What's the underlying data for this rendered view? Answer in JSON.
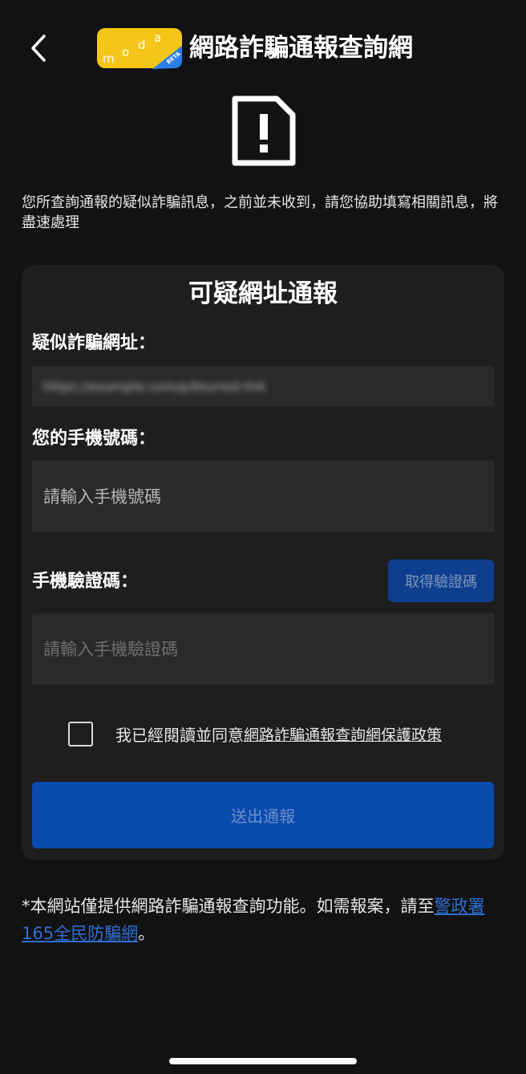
{
  "header": {
    "back_icon": "chevron-left-icon",
    "logo": {
      "text": "moda",
      "badge": "BETA",
      "color": "#f5c518"
    },
    "title": "網路詐騙通報查詢網"
  },
  "alert": {
    "icon": "file-exclamation-icon"
  },
  "intro_text": "您所查詢通報的疑似詐騙訊息，之前並未收到，請您協助填寫相關訊息，將盡速處理",
  "form": {
    "title": "可疑網址通報",
    "url_label": "疑似詐騙網址：",
    "url_value": "https://example.com/p/blurred-link",
    "phone_label": "您的手機號碼：",
    "phone_placeholder": "請輸入手機號碼",
    "code_label": "手機驗證碼：",
    "get_code_button": "取得驗證碼",
    "code_placeholder": "請輸入手機驗證碼",
    "agree_text": "我已經閱讀並同意",
    "agree_link": "網路詐騙通報查詢網保護政策",
    "agreed": false,
    "submit_button": "送出通報"
  },
  "footnote": {
    "text": "*本網站僅提供網路詐騙通報查詢功能。如需報案，請至",
    "link": "警政署165全民防騙網",
    "end": "。"
  },
  "colors": {
    "background": "#121212",
    "card": "#1e1e1e",
    "input": "#2a2a2a",
    "primary_button": "#0a4bb0",
    "link": "#2f6fd6"
  }
}
